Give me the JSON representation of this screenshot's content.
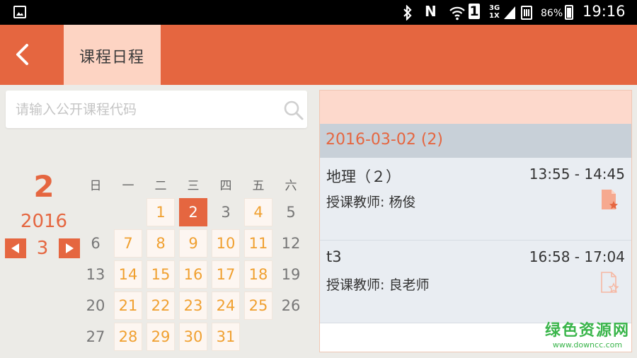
{
  "status_bar": {
    "network": "3G",
    "network2": "1X",
    "sim": "1",
    "n_icon": "N",
    "battery": "86%",
    "time": "19:16",
    "icons": [
      "gallery-icon",
      "bluetooth-icon",
      "nfc-icon",
      "wifi-icon",
      "sim-icon",
      "signal-icon",
      "battery-icon"
    ]
  },
  "header": {
    "back_icon": "chevron-left-icon",
    "title": "课程日程",
    "accent": "#e56640",
    "tab_bg": "#fdd4c3"
  },
  "search": {
    "placeholder": "请输入公开课程代码",
    "value": "",
    "icon": "search-icon"
  },
  "month_nav": {
    "day": "2",
    "year": "2016",
    "month": "3",
    "prev_icon": "triangle-left-icon",
    "next_icon": "triangle-right-icon"
  },
  "calendar": {
    "weekdays": [
      "日",
      "一",
      "二",
      "三",
      "四",
      "五",
      "六"
    ],
    "weeks": [
      [
        null,
        null,
        {
          "d": "1",
          "s": "course"
        },
        {
          "d": "2",
          "s": "selected"
        },
        {
          "d": "3",
          "s": "empty"
        },
        {
          "d": "4",
          "s": "course"
        },
        {
          "d": "5",
          "s": "empty"
        }
      ],
      [
        {
          "d": "6",
          "s": "empty"
        },
        {
          "d": "7",
          "s": "course"
        },
        {
          "d": "8",
          "s": "course"
        },
        {
          "d": "9",
          "s": "course"
        },
        {
          "d": "10",
          "s": "course"
        },
        {
          "d": "11",
          "s": "course"
        },
        {
          "d": "12",
          "s": "empty"
        }
      ],
      [
        {
          "d": "13",
          "s": "empty"
        },
        {
          "d": "14",
          "s": "course"
        },
        {
          "d": "15",
          "s": "course"
        },
        {
          "d": "16",
          "s": "course"
        },
        {
          "d": "17",
          "s": "course"
        },
        {
          "d": "18",
          "s": "course"
        },
        {
          "d": "19",
          "s": "empty"
        }
      ],
      [
        {
          "d": "20",
          "s": "empty"
        },
        {
          "d": "21",
          "s": "course"
        },
        {
          "d": "22",
          "s": "course"
        },
        {
          "d": "23",
          "s": "course"
        },
        {
          "d": "24",
          "s": "course"
        },
        {
          "d": "25",
          "s": "course"
        },
        {
          "d": "26",
          "s": "empty"
        }
      ],
      [
        {
          "d": "27",
          "s": "empty"
        },
        {
          "d": "28",
          "s": "course"
        },
        {
          "d": "29",
          "s": "course"
        },
        {
          "d": "30",
          "s": "course"
        },
        {
          "d": "31",
          "s": "course"
        },
        null,
        null
      ]
    ]
  },
  "schedule": {
    "date_label": "2016-03-02 (2)",
    "courses": [
      {
        "name": "地理（２）",
        "time": "13:55 - 14:45",
        "teacher": "授课教师: 杨俊",
        "icon": "document-star-icon"
      },
      {
        "name": "t3",
        "time": "16:58 - 17:04",
        "teacher": "授课教师: 良老师",
        "icon": "document-star-outline-icon"
      }
    ]
  },
  "watermark": {
    "title": "绿色资源网",
    "url": "www.downcc.com"
  }
}
